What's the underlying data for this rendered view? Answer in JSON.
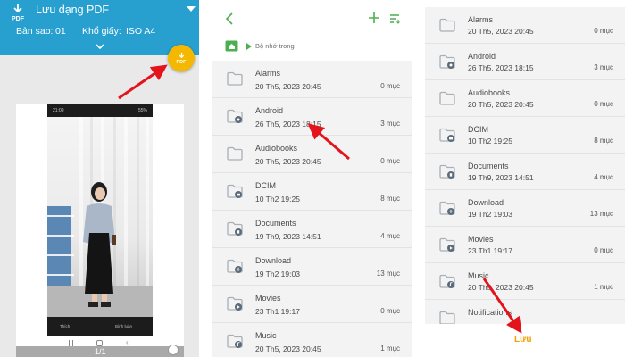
{
  "colors": {
    "header_blue": "#27a0cf",
    "fab_yellow": "#f5b800",
    "folder_gray": "#a9b0b7",
    "green_accent": "#4caf50",
    "save_orange": "#f5a000",
    "arrow_red": "#e3141b"
  },
  "print_panel": {
    "title": "Lưu dạng PDF",
    "copies_label": "Bản sao:",
    "copies_value": "01",
    "paper_label": "Khổ giấy:",
    "paper_value": "ISO A4",
    "fab_label": "PDF",
    "page_indicator": "1/1",
    "preview": {
      "status_time": "21:09",
      "status_battery": "55%",
      "like_label": "Thích",
      "comment_label": "Bình luận"
    }
  },
  "picker_panel": {
    "breadcrumb": "Bộ nhớ trong",
    "items": [
      {
        "name": "Alarms",
        "date": "20 Th5, 2023 20:45",
        "count": "0 mục",
        "badge": ""
      },
      {
        "name": "Android",
        "date": "26 Th5, 2023 18:15",
        "count": "3 mục",
        "badge": "gear"
      },
      {
        "name": "Audiobooks",
        "date": "20 Th5, 2023 20:45",
        "count": "0 mục",
        "badge": ""
      },
      {
        "name": "DCIM",
        "date": "10 Th2 19:25",
        "count": "8 mục",
        "badge": "camera"
      },
      {
        "name": "Documents",
        "date": "19 Th9, 2023 14:51",
        "count": "4 mục",
        "badge": "doc"
      },
      {
        "name": "Download",
        "date": "19 Th2 19:03",
        "count": "13 mục",
        "badge": "download"
      },
      {
        "name": "Movies",
        "date": "23 Th1 19:17",
        "count": "0 mục",
        "badge": "play"
      },
      {
        "name": "Music",
        "date": "20 Th5, 2023 20:45",
        "count": "1 mục",
        "badge": "music"
      }
    ]
  },
  "save_panel": {
    "items": [
      {
        "name": "Alarms",
        "date": "20 Th5, 2023 20:45",
        "count": "0 mục",
        "badge": ""
      },
      {
        "name": "Android",
        "date": "26 Th5, 2023 18:15",
        "count": "3 mục",
        "badge": "gear"
      },
      {
        "name": "Audiobooks",
        "date": "20 Th5, 2023 20:45",
        "count": "0 mục",
        "badge": ""
      },
      {
        "name": "DCIM",
        "date": "10 Th2 19:25",
        "count": "8 mục",
        "badge": "camera"
      },
      {
        "name": "Documents",
        "date": "19 Th9, 2023 14:51",
        "count": "4 mục",
        "badge": "doc"
      },
      {
        "name": "Download",
        "date": "19 Th2 19:03",
        "count": "13 mục",
        "badge": "download"
      },
      {
        "name": "Movies",
        "date": "23 Th1 19:17",
        "count": "0 mục",
        "badge": "play"
      },
      {
        "name": "Music",
        "date": "20 Th5, 2023 20:45",
        "count": "1 mục",
        "badge": "music"
      },
      {
        "name": "Notifications",
        "date": "",
        "count": "",
        "badge": ""
      }
    ],
    "save_label": "Lưu"
  }
}
